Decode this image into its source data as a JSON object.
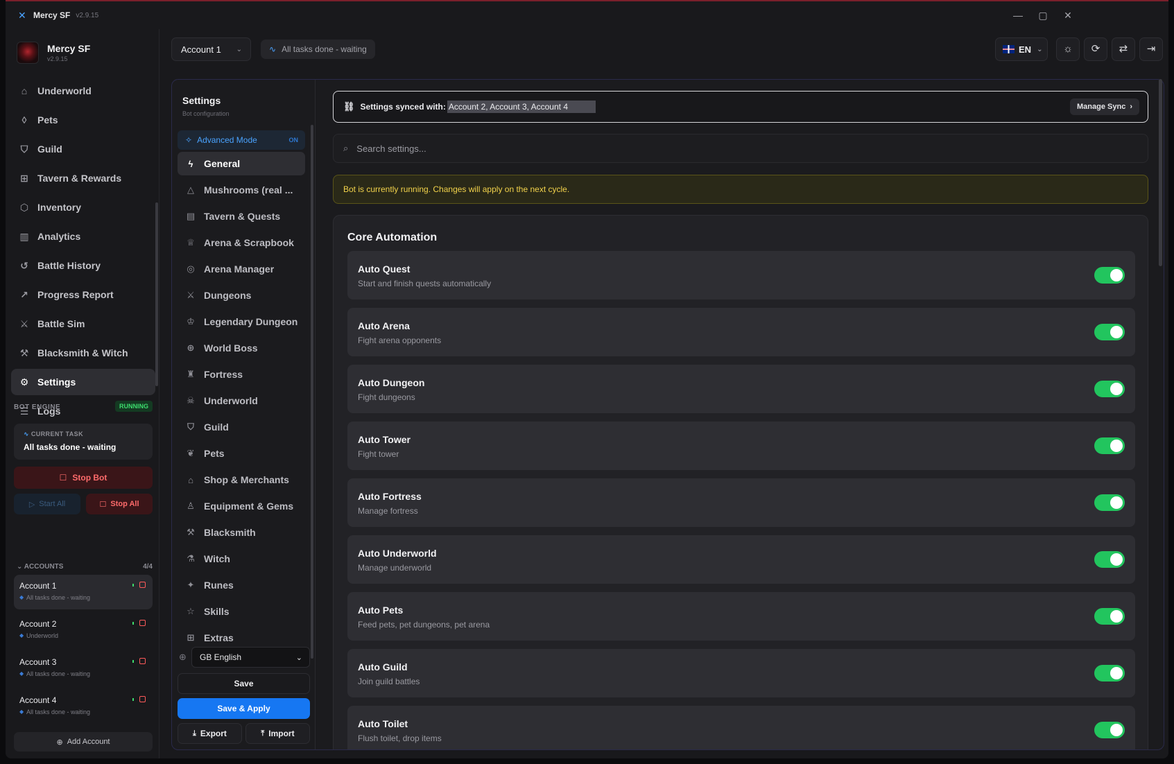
{
  "app": {
    "title": "Mercy SF",
    "version": "v2.9.15"
  },
  "sidebar": {
    "brand_name": "Mercy SF",
    "brand_version": "v2.9.15",
    "items": [
      {
        "label": "Underworld",
        "icon": "home-icon"
      },
      {
        "label": "Pets",
        "icon": "shield-icon"
      },
      {
        "label": "Guild",
        "icon": "shield-icon"
      },
      {
        "label": "Tavern & Rewards",
        "icon": "gift-icon"
      },
      {
        "label": "Inventory",
        "icon": "box-icon"
      },
      {
        "label": "Analytics",
        "icon": "bar-chart-icon"
      },
      {
        "label": "Battle History",
        "icon": "history-icon"
      },
      {
        "label": "Progress Report",
        "icon": "trend-icon"
      },
      {
        "label": "Battle Sim",
        "icon": "swords-icon"
      },
      {
        "label": "Blacksmith & Witch",
        "icon": "hammer-icon"
      },
      {
        "label": "Settings",
        "icon": "gear-icon"
      },
      {
        "label": "Logs",
        "icon": "scroll-icon"
      }
    ],
    "active": "Settings",
    "engine_label": "BOT ENGINE",
    "engine_status": "RUNNING",
    "current_task_label": "CURRENT TASK",
    "current_task": "All tasks done - waiting",
    "stop_bot": "Stop Bot",
    "start_all": "Start All",
    "stop_all": "Stop All",
    "accounts_label": "ACCOUNTS",
    "accounts_count": "4/4",
    "accounts": [
      {
        "name": "Account 1",
        "status": "All tasks done - waiting"
      },
      {
        "name": "Account 2",
        "status": "Underworld"
      },
      {
        "name": "Account 3",
        "status": "All tasks done - waiting"
      },
      {
        "name": "Account 4",
        "status": "All tasks done - waiting"
      }
    ],
    "add_account": "Add Account"
  },
  "topbar": {
    "account_selected": "Account 1",
    "status": "All tasks done - waiting",
    "language": "EN"
  },
  "settings_nav": {
    "title": "Settings",
    "subtitle": "Bot configuration",
    "advanced_label": "Advanced Mode",
    "advanced_state": "ON",
    "items": [
      {
        "label": "General",
        "icon": "bolt-icon"
      },
      {
        "label": "Mushrooms (real ...",
        "icon": "warning-icon"
      },
      {
        "label": "Tavern & Quests",
        "icon": "mug-icon"
      },
      {
        "label": "Arena & Scrapbook",
        "icon": "trophy-icon"
      },
      {
        "label": "Arena Manager",
        "icon": "target-icon"
      },
      {
        "label": "Dungeons",
        "icon": "swords-icon"
      },
      {
        "label": "Legendary Dungeon",
        "icon": "crown-icon"
      },
      {
        "label": "World Boss",
        "icon": "globe-icon"
      },
      {
        "label": "Fortress",
        "icon": "castle-icon"
      },
      {
        "label": "Underworld",
        "icon": "skull-icon"
      },
      {
        "label": "Guild",
        "icon": "shield-icon"
      },
      {
        "label": "Pets",
        "icon": "paw-icon"
      },
      {
        "label": "Shop & Merchants",
        "icon": "shop-icon"
      },
      {
        "label": "Equipment & Gems",
        "icon": "shirt-icon"
      },
      {
        "label": "Blacksmith",
        "icon": "hammer-icon"
      },
      {
        "label": "Witch",
        "icon": "flask-icon"
      },
      {
        "label": "Runes",
        "icon": "sparkle-icon"
      },
      {
        "label": "Skills",
        "icon": "star-icon"
      },
      {
        "label": "Extras",
        "icon": "gift-icon"
      }
    ],
    "active": "General",
    "language_select": "GB English",
    "save": "Save",
    "save_apply": "Save & Apply",
    "export": "Export",
    "import": "Import"
  },
  "content": {
    "sync_label": "Settings synced with:",
    "sync_accounts": "Account 2, Account 3, Account 4",
    "manage_sync": "Manage Sync",
    "search_placeholder": "Search settings...",
    "warning": "Bot is currently running. Changes will apply on the next cycle.",
    "section_title": "Core Automation",
    "toggles": [
      {
        "name": "Auto Quest",
        "desc": "Start and finish quests automatically",
        "on": true
      },
      {
        "name": "Auto Arena",
        "desc": "Fight arena opponents",
        "on": true
      },
      {
        "name": "Auto Dungeon",
        "desc": "Fight dungeons",
        "on": true
      },
      {
        "name": "Auto Tower",
        "desc": "Fight tower",
        "on": true
      },
      {
        "name": "Auto Fortress",
        "desc": "Manage fortress",
        "on": true
      },
      {
        "name": "Auto Underworld",
        "desc": "Manage underworld",
        "on": true
      },
      {
        "name": "Auto Pets",
        "desc": "Feed pets, pet dungeons, pet arena",
        "on": true
      },
      {
        "name": "Auto Guild",
        "desc": "Join guild battles",
        "on": true
      },
      {
        "name": "Auto Toilet",
        "desc": "Flush toilet, drop items",
        "on": true
      }
    ]
  },
  "colors": {
    "accent": "#1677f2",
    "success": "#22c55e",
    "danger": "#ff5a5a",
    "warning": "#f2d24b"
  }
}
